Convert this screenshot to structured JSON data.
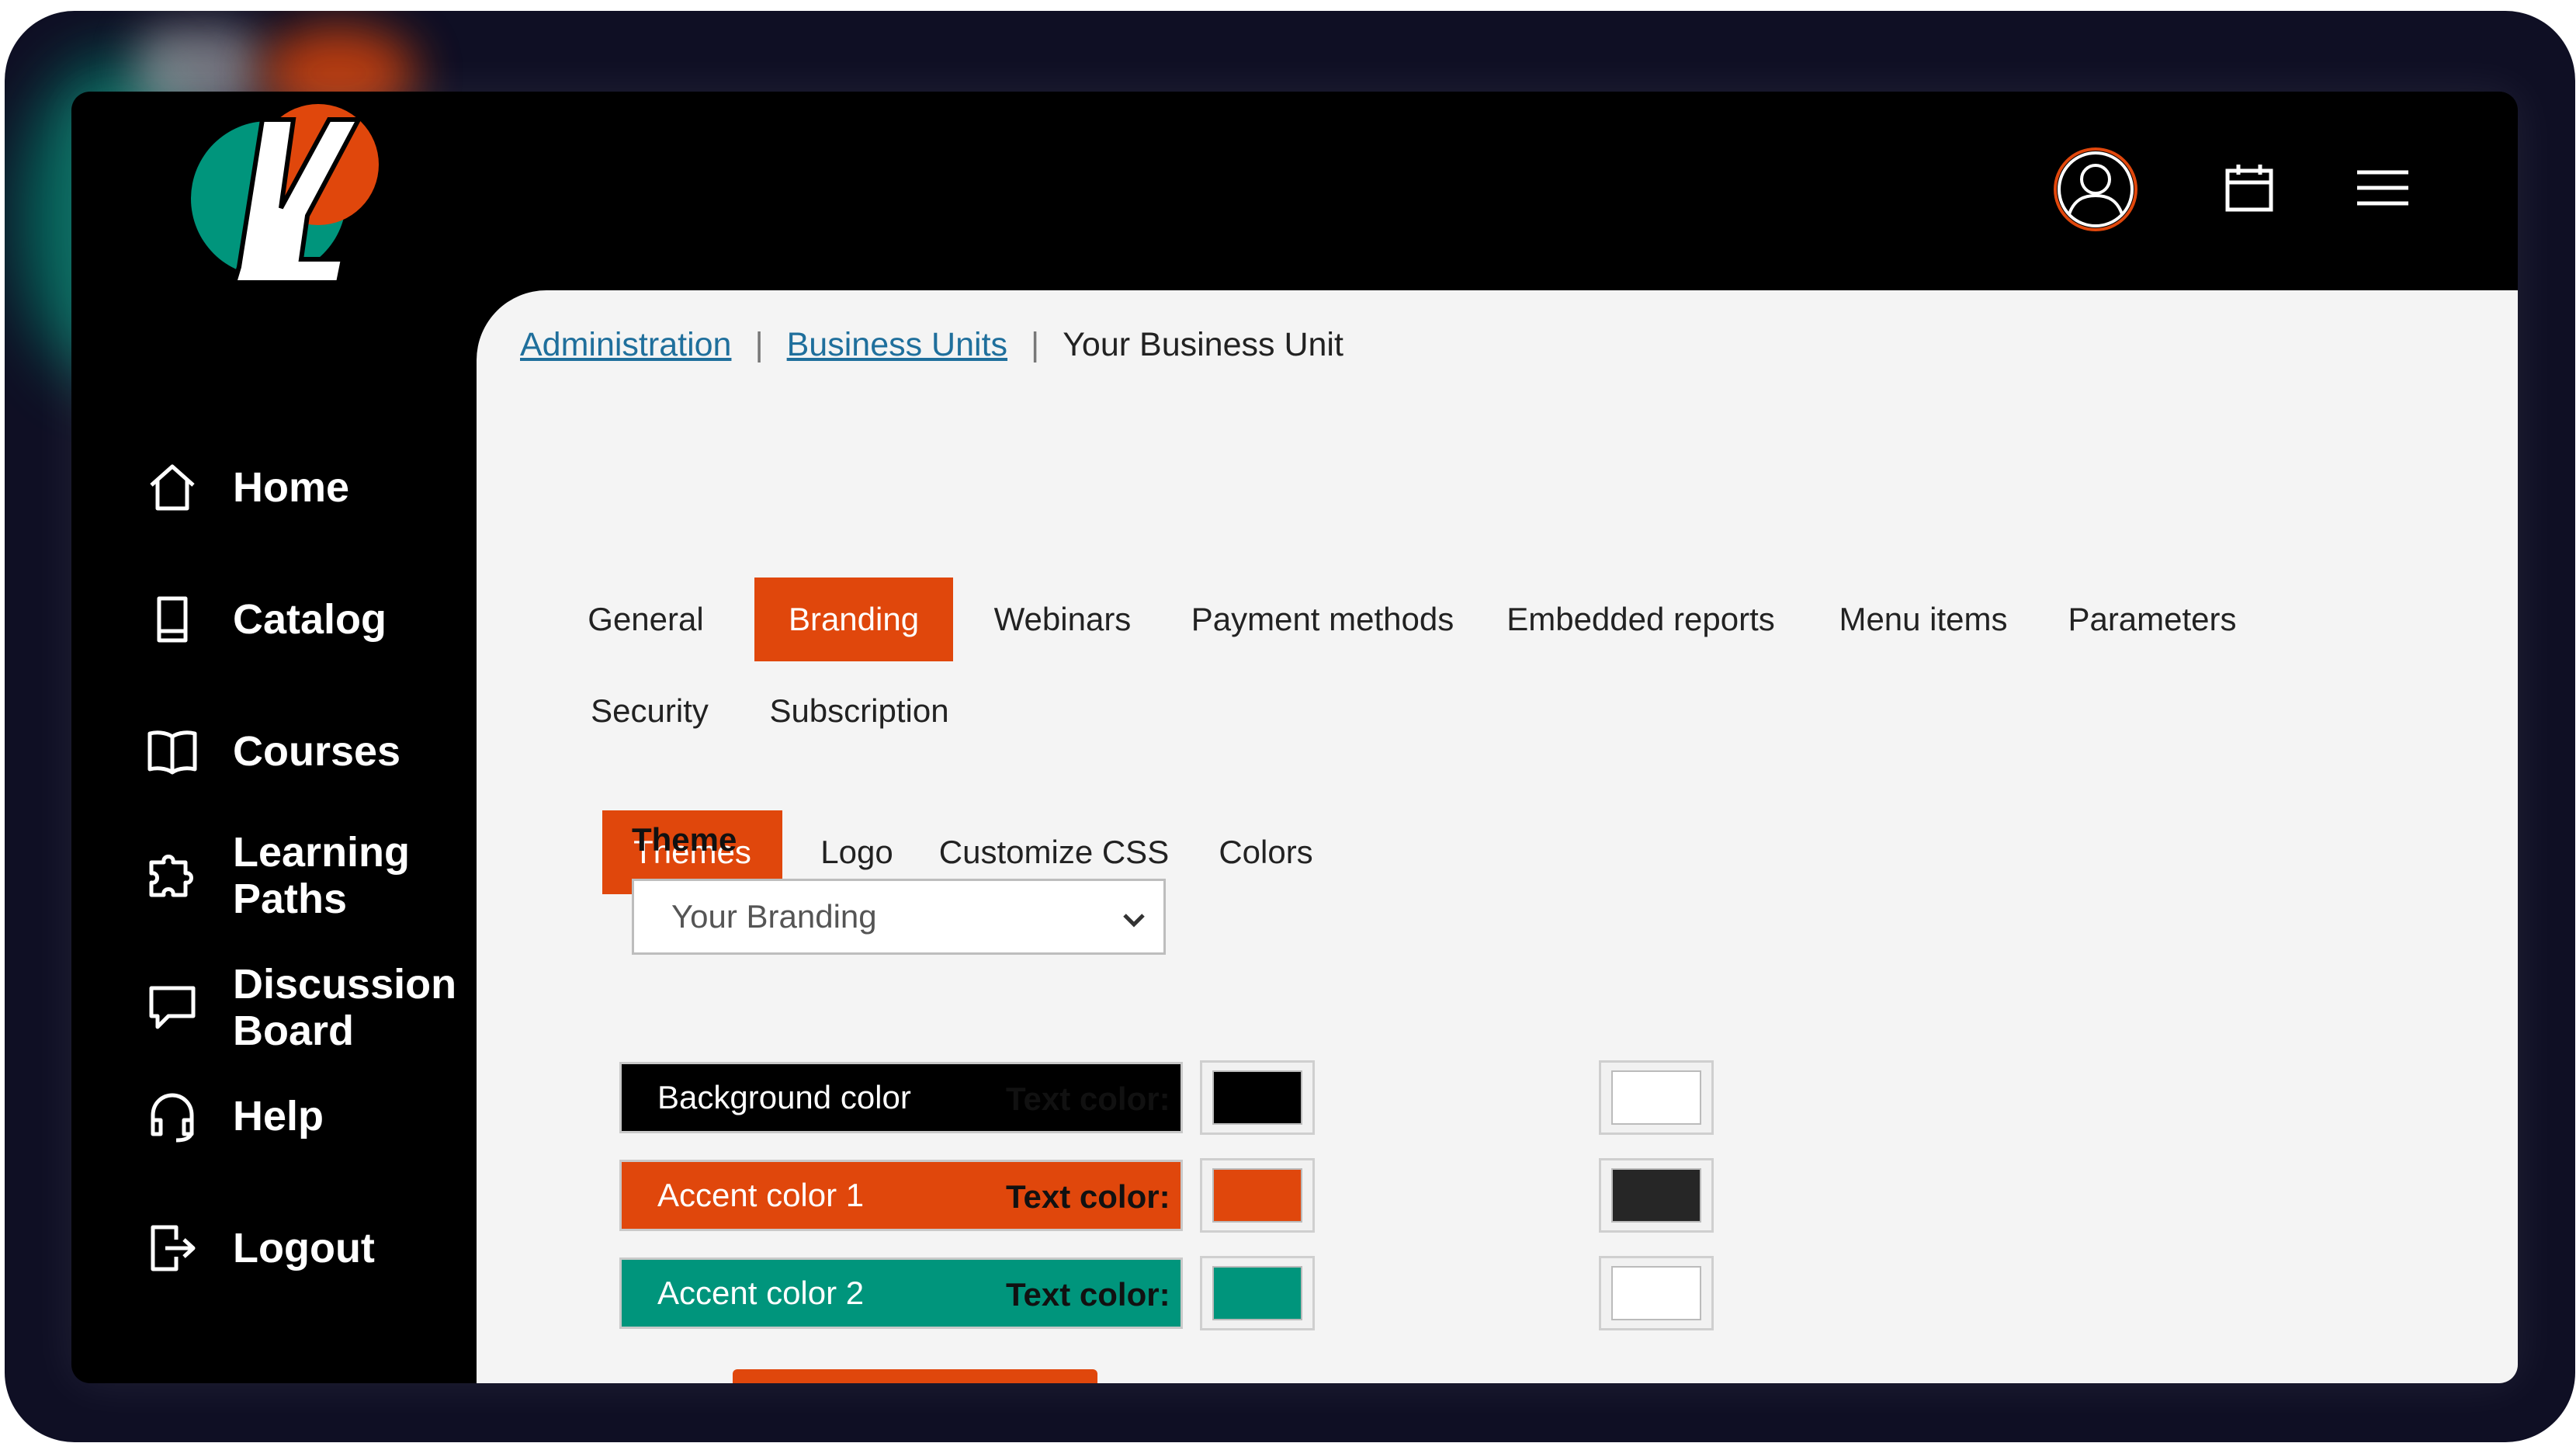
{
  "colors": {
    "accent_orange": "#e0470c",
    "accent_teal": "#00957c",
    "background": "#000000",
    "content_bg": "#f4f4f4",
    "link": "#1f6f9c"
  },
  "header": {
    "logo_icon": "ly-logo-icon",
    "icons": [
      "user-profile-icon",
      "calendar-icon",
      "hamburger-menu-icon"
    ]
  },
  "sidebar": {
    "items": [
      {
        "label": "Home",
        "icon": "home-icon"
      },
      {
        "label": "Catalog",
        "icon": "book-icon"
      },
      {
        "label": "Courses",
        "icon": "open-book-icon"
      },
      {
        "label": "Learning\nPaths",
        "icon": "puzzle-icon"
      },
      {
        "label": "Discussion\nBoard",
        "icon": "chat-icon"
      },
      {
        "label": "Help",
        "icon": "headset-icon"
      },
      {
        "label": "Logout",
        "icon": "logout-icon"
      }
    ]
  },
  "breadcrumb": {
    "items": [
      "Administration",
      "Business Units",
      "Your Business Unit"
    ],
    "separator": "|"
  },
  "main_tabs": [
    {
      "label": "General",
      "active": false
    },
    {
      "label": "Branding",
      "active": true
    },
    {
      "label": "Webinars",
      "active": false
    },
    {
      "label": "Payment methods",
      "active": false
    },
    {
      "label": "Embedded reports",
      "active": false
    },
    {
      "label": "Menu items",
      "active": false
    },
    {
      "label": "Parameters",
      "active": false
    },
    {
      "label": "Security",
      "active": false
    },
    {
      "label": "Subscription",
      "active": false
    }
  ],
  "sub_tabs": [
    {
      "label": "Themes",
      "active": true
    },
    {
      "label": "Logo",
      "active": false
    },
    {
      "label": "Customize CSS",
      "active": false
    },
    {
      "label": "Colors",
      "active": false
    }
  ],
  "theme": {
    "label": "Theme",
    "selected": "Your Branding"
  },
  "color_rows": [
    {
      "label": "Background color",
      "color": "#000000",
      "text_color_label": "Text color:",
      "text_color": "#ffffff"
    },
    {
      "label": "Accent color 1",
      "color": "#e0470c",
      "text_color_label": "Text color:",
      "text_color": "#262626"
    },
    {
      "label": "Accent color 2",
      "color": "#00957c",
      "text_color_label": "Text color:",
      "text_color": "#ffffff"
    }
  ]
}
